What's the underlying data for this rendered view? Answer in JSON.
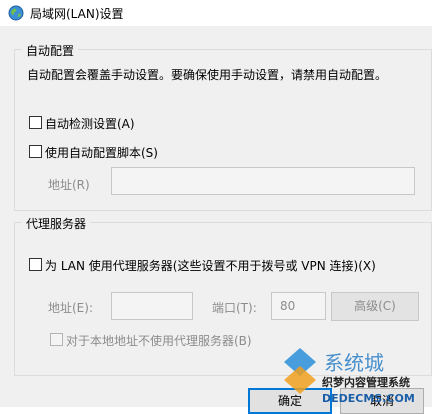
{
  "window": {
    "title": "局域网(LAN)设置"
  },
  "auto_config": {
    "group_title": "自动配置",
    "description": "自动配置会覆盖手动设置。要确保使用手动设置，请禁用自动配置。",
    "auto_detect": {
      "label": "自动检测设置(A)",
      "checked": false
    },
    "use_script": {
      "label": "使用自动配置脚本(S)",
      "checked": false
    },
    "address_label": "地址(R)",
    "address_value": ""
  },
  "proxy": {
    "group_title": "代理服务器",
    "use_proxy": {
      "label": "为 LAN 使用代理服务器(这些设置不用于拨号或 VPN 连接)(X)",
      "checked": false
    },
    "address_label": "地址(E):",
    "address_value": "",
    "port_label": "端口(T):",
    "port_value": "80",
    "advanced_label": "高级(C)",
    "bypass_local": {
      "label": "对于本地地址不使用代理服务器(B)",
      "checked": false
    }
  },
  "buttons": {
    "ok_label": "确定",
    "cancel_label": "取消"
  },
  "watermark": {
    "brand": "系统城",
    "site_cn": "织梦内容管理系统",
    "site_url": "DEDECMS.COM"
  },
  "colors": {
    "accent": "#0078d7",
    "disabled_text": "#8c8c8c",
    "dialog_bg": "#f0f0f0"
  }
}
